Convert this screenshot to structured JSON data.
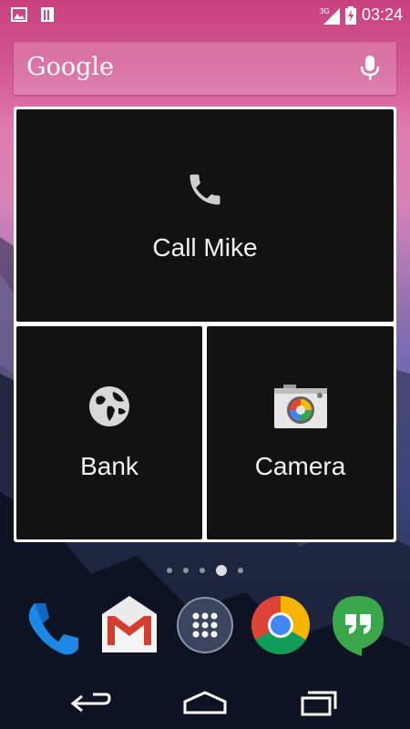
{
  "status_bar": {
    "time": "03:24",
    "network": "3G",
    "left_icons": [
      "image-notification-icon",
      "sim-notification-icon"
    ],
    "right_icons": [
      "signal-icon",
      "battery-charging-icon"
    ]
  },
  "search": {
    "logo": "Google",
    "icon": "mic-icon"
  },
  "widget": {
    "tiles": [
      {
        "label": "Call Mike",
        "icon": "phone-icon"
      },
      {
        "label": "Bank",
        "icon": "globe-icon"
      },
      {
        "label": "Camera",
        "icon": "camera-icon"
      }
    ]
  },
  "pages": {
    "count": 5,
    "active": 4
  },
  "dock": {
    "apps": [
      {
        "name": "phone-app-icon"
      },
      {
        "name": "gmail-app-icon"
      },
      {
        "name": "app-drawer-icon"
      },
      {
        "name": "chrome-app-icon"
      },
      {
        "name": "hangouts-app-icon"
      }
    ]
  },
  "nav": [
    "back-icon",
    "home-icon",
    "recents-icon"
  ],
  "colors": {
    "tile_bg": "#121212",
    "widget_border": "#ffffff",
    "phone_blue": "#1e88e5",
    "gmail_red": "#d23f31",
    "hangouts_green": "#3aa74a"
  }
}
